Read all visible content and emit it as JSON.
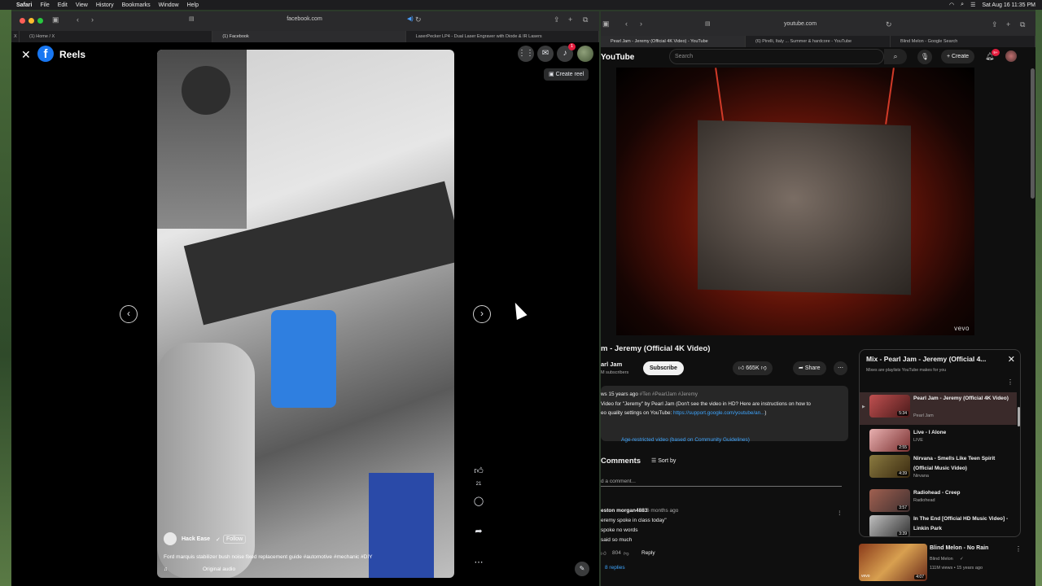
{
  "menubar": {
    "apple": "",
    "app": "Safari",
    "items": [
      "File",
      "Edit",
      "View",
      "History",
      "Bookmarks",
      "Window",
      "Help"
    ],
    "datetime": "Sat Aug 16  11:35 PM"
  },
  "facebook_window": {
    "address": "facebook.com",
    "tabs": [
      "(1) Home / X",
      "(1) Facebook",
      "LaserPecker LP4 - Dual Laser Engraver with Diode & IR Lasers"
    ],
    "header_title": "Reels",
    "notifications_count": "1",
    "create_reel_label": "Create reel",
    "reel": {
      "author": "Hack Ease",
      "follow_label": "Follow",
      "caption": "Ford marquis stabilizer bush noise fixed replacement guide #automotive #mechanic #DIY",
      "audio": "Original audio",
      "like_count": "21"
    },
    "colors": {
      "accent": "#1877f2",
      "badge": "#e41e3f"
    }
  },
  "youtube_window": {
    "address": "youtube.com",
    "tabs": [
      "Pearl Jam - Jeremy (Official 4K Video) - YouTube",
      "(6) Pirelli, Italy ... Summer & hardcore - YouTube",
      "Blind Melon - Google Search"
    ],
    "logo": "YouTube",
    "search_placeholder": "Search",
    "create_label": "Create",
    "notifications_count": "9+",
    "watermark": "vevo",
    "video_title": "m - Jeremy (Official 4K Video)",
    "channel": "arl Jam",
    "subscribers": "M subscribers",
    "subscribe_label": "Subscribe",
    "likes": "665K",
    "share_label": "Share",
    "description": {
      "line1_meta": "ws  15 years ago",
      "line1_tags": "#Ten #PearlJam #Jeremy",
      "line2": "Video for \"Jeremy\" by Pearl Jam (Don't see the video in HD? Here are instructions on how to",
      "line3_prefix": "eo quality settings on YouTube: ",
      "line3_link": "https://support.google.com/youtube/an...",
      "line3_suffix": ")"
    },
    "age_restriction": "Age-restricted video (based on Community Guidelines)",
    "comments_label": "Comments",
    "sort_label": "Sort by",
    "add_comment_placeholder": "d a comment...",
    "comment": {
      "author": "eston morgan4883",
      "time": "6 months ago",
      "lines": [
        "eremy spoke in class today\"",
        "spoke no words",
        "said so much"
      ],
      "likes": "804",
      "reply_label": "Reply",
      "replies": "8 replies"
    },
    "mix": {
      "title": "Mix - Pearl Jam - Jeremy (Official 4...",
      "subtitle": "Mixes are playlists YouTube makes for you",
      "items": [
        {
          "title": "Pearl Jam - Jeremy (Official 4K Video)",
          "artist": "Pearl Jam",
          "duration": "5:34",
          "active": true
        },
        {
          "title": "Live - I Alone",
          "artist": "LIVE",
          "duration": "2:55",
          "active": false
        },
        {
          "title": "Nirvana - Smells Like Teen Spirit (Official Music Video)",
          "artist": "Nirvana",
          "duration": "4:39",
          "active": false
        },
        {
          "title": "Radiohead - Creep",
          "artist": "Radiohead",
          "duration": "3:57",
          "active": false
        },
        {
          "title": "In The End [Official HD Music Video] - Linkin Park",
          "artist": "",
          "duration": "3:39",
          "active": false
        }
      ]
    },
    "recommendation": {
      "title": "Blind Melon - No Rain",
      "channel": "Blind Melon",
      "meta": "111M views • 15 years ago",
      "duration": "4:07",
      "watermark": "vevo"
    }
  }
}
